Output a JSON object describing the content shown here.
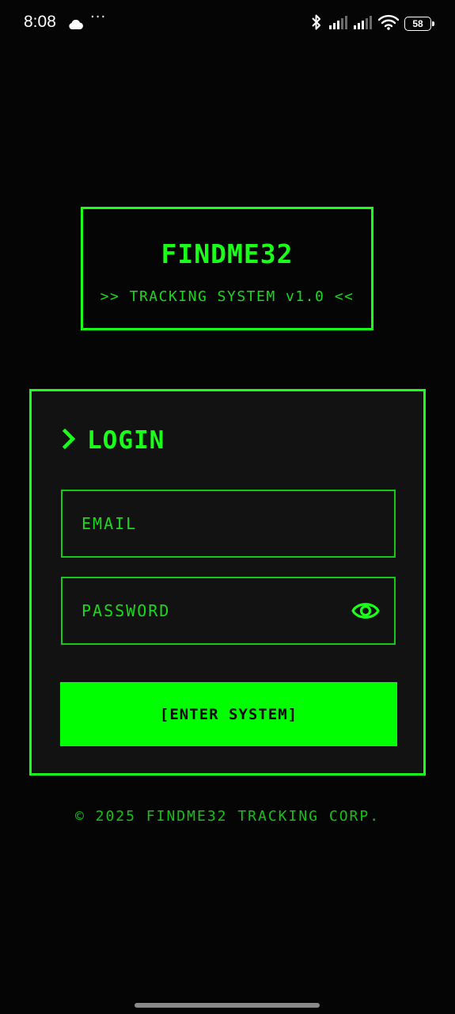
{
  "status_bar": {
    "time": "8:08",
    "more": "···",
    "battery": "58",
    "icons": [
      "cloud-icon",
      "bluetooth-icon",
      "signal-icon",
      "signal-icon",
      "wifi-icon",
      "battery-icon"
    ]
  },
  "header": {
    "title": "FINDME32",
    "subtitle": ">> TRACKING SYSTEM v1.0 <<"
  },
  "login": {
    "heading": "LOGIN",
    "heading_icon": "chevron-right-icon",
    "email_placeholder": "EMAIL",
    "email_value": "",
    "password_placeholder": "PASSWORD",
    "password_value": "",
    "password_toggle_icon": "eye-icon",
    "submit_label": "[ENTER SYSTEM]"
  },
  "footer": {
    "copyright": "© 2025 FINDME32 TRACKING CORP."
  },
  "colors": {
    "background": "#050505",
    "card": "#121212",
    "accent": "#1aff1a",
    "button": "#00ff00",
    "button_text": "#0a0a0a"
  }
}
